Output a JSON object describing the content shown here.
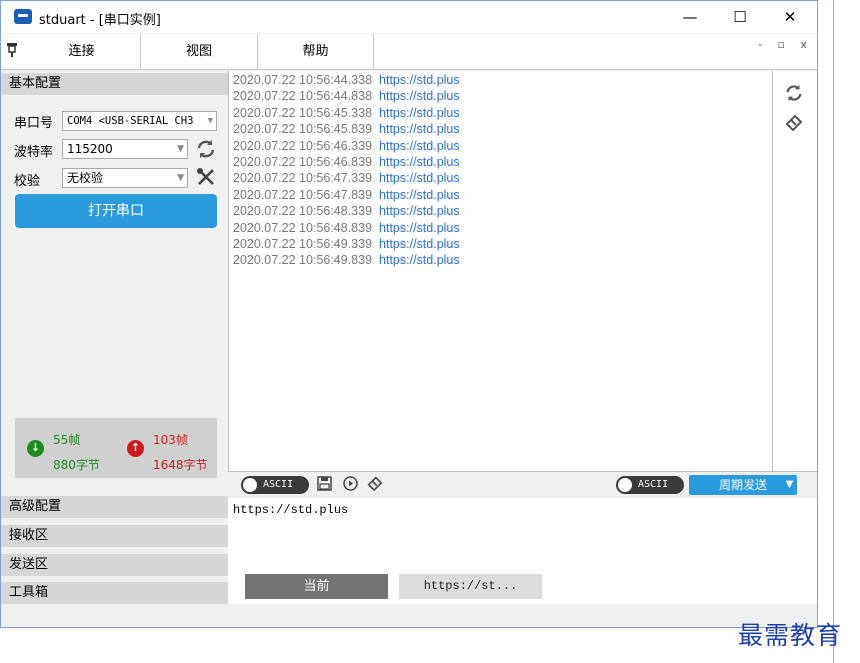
{
  "window": {
    "title": "stduart - [串口实例]",
    "minimize": "—",
    "maximize": "☐",
    "close": "✕"
  },
  "menubar": {
    "items": [
      "连接",
      "视图",
      "帮助"
    ],
    "mdi_controls": "- ▫ x"
  },
  "left": {
    "basic_header": "基本配置",
    "port_label": "串口号",
    "port_value": "COM4 <USB-SERIAL CH3",
    "baud_label": "波特率",
    "baud_value": "115200",
    "parity_label": "校验",
    "parity_value": "无校验",
    "open_button": "打开串口",
    "stats": {
      "rx_frames": "55帧",
      "rx_bytes": "880字节",
      "tx_frames": "103帧",
      "tx_bytes": "1648字节"
    },
    "sections": [
      "高级配置",
      "接收区",
      "发送区",
      "工具箱"
    ]
  },
  "log": [
    {
      "ts": "2020.07.22 10:56:44.338",
      "msg": "https://std.plus"
    },
    {
      "ts": "2020.07.22 10:56:44.838",
      "msg": "https://std.plus"
    },
    {
      "ts": "2020.07.22 10:56:45.338",
      "msg": "https://std.plus"
    },
    {
      "ts": "2020.07.22 10:56:45.839",
      "msg": "https://std.plus"
    },
    {
      "ts": "2020.07.22 10:56:46.339",
      "msg": "https://std.plus"
    },
    {
      "ts": "2020.07.22 10:56:46.839",
      "msg": "https://std.plus"
    },
    {
      "ts": "2020.07.22 10:56:47.339",
      "msg": "https://std.plus"
    },
    {
      "ts": "2020.07.22 10:56:47.839",
      "msg": "https://std.plus"
    },
    {
      "ts": "2020.07.22 10:56:48.339",
      "msg": "https://std.plus"
    },
    {
      "ts": "2020.07.22 10:56:48.839",
      "msg": "https://std.plus"
    },
    {
      "ts": "2020.07.22 10:56:49.339",
      "msg": "https://std.plus"
    },
    {
      "ts": "2020.07.22 10:56:49.839",
      "msg": "https://std.plus"
    }
  ],
  "toolbar": {
    "rx_ascii": "ASCII",
    "tx_ascii": "ASCII",
    "periodic_send": "周期发送"
  },
  "send": {
    "text": "https://std.plus",
    "tab_current": "当前",
    "tab_history": "https://st..."
  },
  "watermark": "最需教育",
  "colors": {
    "accent": "#2a9bdc",
    "rx": "#1d8a1d",
    "tx": "#c81e1e",
    "link": "#2a6fdb"
  }
}
